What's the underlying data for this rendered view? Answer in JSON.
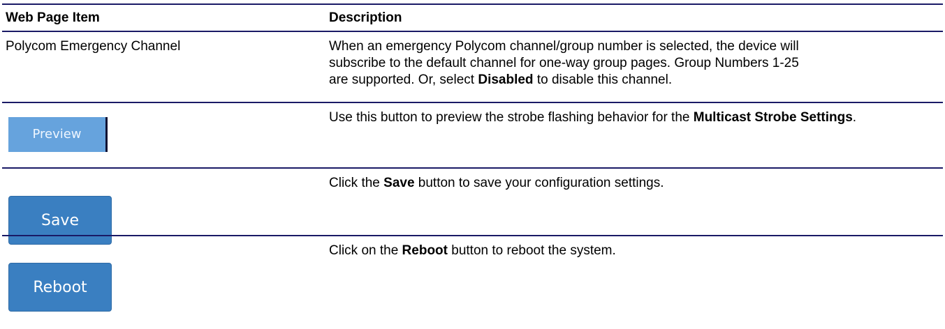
{
  "header": {
    "col1": "Web Page Item",
    "col2": "Description"
  },
  "rows": {
    "polycom": {
      "item": "Polycom Emergency Channel",
      "desc_line1": "When an emergency Polycom channel/group number is selected, the device will",
      "desc_line2": "subscribe to the default channel for one-way group pages. Group Numbers 1-25",
      "desc_line3_pre": "are supported. Or, select ",
      "desc_line3_bold": "Disabled",
      "desc_line3_post": " to disable this channel."
    },
    "preview": {
      "button_label": "Preview",
      "desc_pre": "Use this button to preview the strobe flashing behavior for the ",
      "desc_bold": "Multicast Strobe Settings",
      "desc_post": "."
    },
    "save": {
      "button_label": "Save",
      "desc_pre": "Click the ",
      "desc_bold": "Save",
      "desc_post": " button to save your configuration settings."
    },
    "reboot": {
      "button_label": "Reboot",
      "desc_pre": "Click on the ",
      "desc_bold": "Reboot",
      "desc_post": " button to reboot the system."
    }
  }
}
